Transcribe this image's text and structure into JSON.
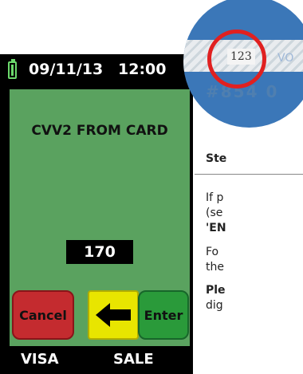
{
  "status": {
    "date": "09/11/13",
    "time": "12:00"
  },
  "screen": {
    "title": "CVV2 FROM CARD",
    "entry_value": "170"
  },
  "buttons": {
    "cancel_label": "Cancel",
    "back_icon": "arrow-left-icon",
    "enter_label": "Enter"
  },
  "bottom": {
    "card_type": "VISA",
    "transaction_type": "SALE"
  },
  "card_image": {
    "cvv": "123",
    "fragment": "VO",
    "lower_fragment": "#854 0"
  },
  "side": {
    "heading": "Ste",
    "line1": "If p",
    "line2": "(se",
    "line3": "'EN",
    "line4": "Fo",
    "line5": "the",
    "line6": "Ple",
    "line7": "dig"
  },
  "colors": {
    "screen_bg": "#5aa25f",
    "cancel": "#c42b2f",
    "back": "#e8e500",
    "enter": "#2a9a3a",
    "ring": "#e02020"
  }
}
